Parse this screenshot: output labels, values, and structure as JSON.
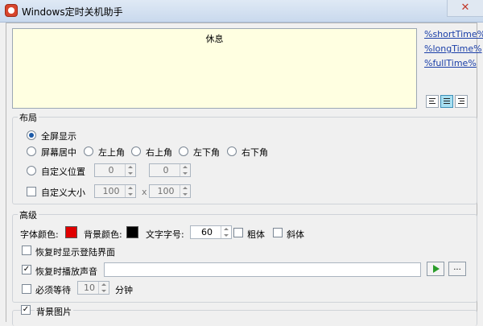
{
  "window": {
    "title": "Windows定时关机助手",
    "close_glyph": "✕"
  },
  "preview": {
    "text": "休息"
  },
  "variables": [
    "%shortTime%",
    "%longTime%",
    "%fullTime%"
  ],
  "align_buttons": [
    {
      "name": "align-left-icon",
      "active": false
    },
    {
      "name": "align-center-icon",
      "active": true
    },
    {
      "name": "align-right-icon",
      "active": false
    }
  ],
  "layout_group": {
    "title": "布局",
    "fullscreen": "全屏显示",
    "screen_center": "屏幕居中",
    "top_left": "左上角",
    "top_right": "右上角",
    "bottom_left": "左下角",
    "bottom_right": "右下角",
    "custom_position": "自定义位置",
    "pos_x": "0",
    "pos_y": "0",
    "custom_size": "自定义大小",
    "size_w": "100",
    "size_x_sep": "x",
    "size_h": "100"
  },
  "advanced_group": {
    "title": "高级",
    "font_color_label": "字体颜色:",
    "font_color": "#e00000",
    "bg_color_label": "背景颜色:",
    "bg_color": "#000000",
    "font_size_label": "文字字号:",
    "font_size": "60",
    "bold": "粗体",
    "italic": "斜体",
    "show_login": "恢复时显示登陆界面",
    "play_sound": "恢复时播放声音",
    "sound_path": "",
    "browse": "...",
    "must_wait": "必须等待",
    "wait_value": "10",
    "minutes": "分钟"
  },
  "bg_image_group": {
    "title": "背景图片"
  },
  "check_mark": "✓"
}
